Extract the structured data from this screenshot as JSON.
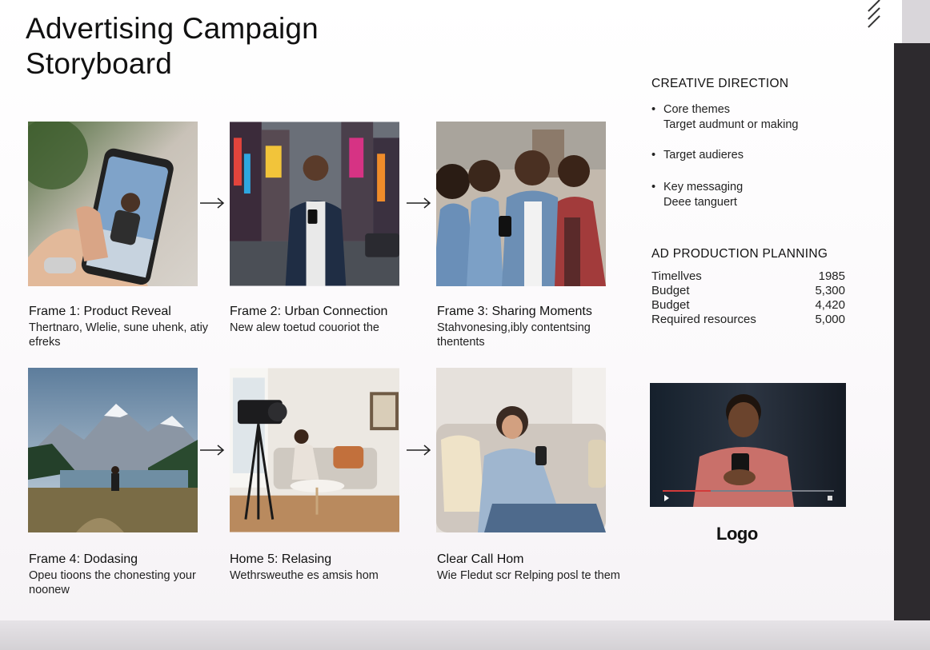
{
  "title": "Advertising Campaign Storyboard",
  "frames": [
    {
      "title": "Frame 1: Product Reveal",
      "desc": "Thertnaro, Wlelie, sune uhenk, atiy efreks",
      "icon": "phone-in-hand"
    },
    {
      "title": "Frame 2: Urban Connection",
      "desc": "New alew toetud couoriot the",
      "icon": "city-street-man"
    },
    {
      "title": "Frame 3: Sharing Moments",
      "desc": "Stahvonesing,ibly contentsing thentents",
      "icon": "group-friends"
    },
    {
      "title": "Frame 4: Dodasing",
      "desc": "Opeu tioons the chonesting your noonew",
      "icon": "mountain-lake"
    },
    {
      "title": "Home 5: Relasing",
      "desc": "Wethrsweuthe es amsis hom",
      "icon": "camera-living-room"
    },
    {
      "title": "Clear Call Hom",
      "desc": "Wie Fledut scr Relping posl te them",
      "icon": "woman-couch-phone"
    }
  ],
  "creative": {
    "heading": "CREATIVE DIRECTION",
    "items": [
      {
        "label": "Core themes",
        "sub": "Target audmunt or making"
      },
      {
        "label": "Target audieres",
        "sub": ""
      },
      {
        "label": "Key messaging",
        "sub": "Deee tanguert"
      }
    ]
  },
  "production": {
    "heading": "AD PRODUCTION PLANNING",
    "rows": [
      {
        "label": "Timellves",
        "value": "1985"
      },
      {
        "label": "Budget",
        "value": "5,300"
      },
      {
        "label": "Budget",
        "value": "4,420"
      },
      {
        "label": "Required resources",
        "value": "5,000"
      }
    ]
  },
  "logo": "Logo",
  "colors": {
    "accent_red": "#d23a3a",
    "panel": "#2d2a2e"
  }
}
